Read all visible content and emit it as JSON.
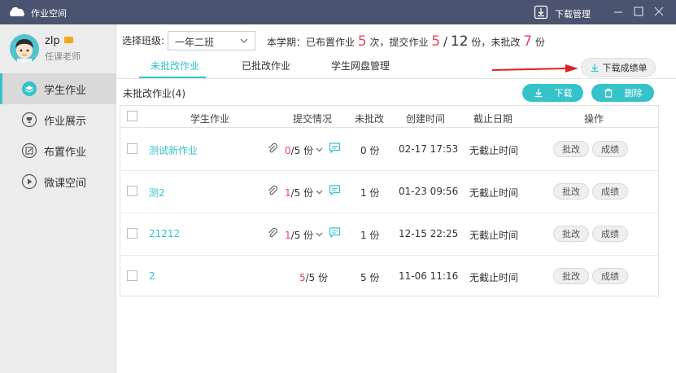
{
  "app": {
    "title": "作业空间",
    "download_manager": "下载管理"
  },
  "user": {
    "name": "zlp",
    "role": "任课老师"
  },
  "nav": [
    {
      "label": "学生作业",
      "icon": "layers-icon",
      "active": true
    },
    {
      "label": "作业展示",
      "icon": "trophy-icon",
      "active": false
    },
    {
      "label": "布置作业",
      "icon": "edit-icon",
      "active": false
    },
    {
      "label": "微课空间",
      "icon": "play-icon",
      "active": false
    }
  ],
  "filter": {
    "label": "选择班级:",
    "selected": "一年二班"
  },
  "stats": {
    "prefix": "本学期：已布置作业",
    "assigned": "5",
    "assigned_unit": "次，提交作业",
    "submitted": "5",
    "slash": "/",
    "total": "12",
    "total_unit": "份，未批改",
    "ungraded": "7",
    "ungraded_unit": "份"
  },
  "tabs": [
    "未批改作业",
    "已批改作业",
    "学生网盘管理"
  ],
  "download_report": "下载成绩单",
  "section_title": "未批改作业(4)",
  "buttons": {
    "download": "下载",
    "delete": "删除"
  },
  "table": {
    "headers": [
      "学生作业",
      "提交情况",
      "未批改",
      "创建时间",
      "截止日期",
      "操作"
    ],
    "rows": [
      {
        "name": "测试新作业",
        "submitted": "0",
        "total": "/5 份",
        "ungraded": "0 份",
        "created": "02-17 17:53",
        "deadline": "无截止时间",
        "grade": "批改",
        "score": "成绩",
        "has_attach": true
      },
      {
        "name": "测2",
        "submitted": "1",
        "total": "/5 份",
        "ungraded": "1 份",
        "created": "01-23 09:56",
        "deadline": "无截止时间",
        "grade": "批改",
        "score": "成绩",
        "has_attach": true
      },
      {
        "name": "21212",
        "submitted": "1",
        "total": "/5 份",
        "ungraded": "1 份",
        "created": "12-15 22:25",
        "deadline": "无截止时间",
        "grade": "批改",
        "score": "成绩",
        "has_attach": true
      },
      {
        "name": "2",
        "submitted": "5",
        "total": "/5 份",
        "ungraded": "5 份",
        "created": "11-06 11:16",
        "deadline": "无截止时间",
        "grade": "批改",
        "score": "成绩",
        "has_attach": false
      }
    ]
  },
  "colors": {
    "accent": "#36c2c9",
    "titlebar": "#4a5470",
    "highlight": "#e5455a"
  }
}
